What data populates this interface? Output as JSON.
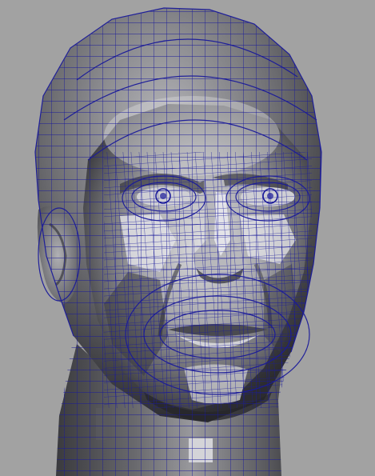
{
  "viewport": {
    "background_color": "#a2a2a2",
    "wireframe_color": "#1a1a9a",
    "mesh_shade_light": "#d8d8da",
    "mesh_shade_mid": "#8a8a8e",
    "mesh_shade_dark": "#3a3a3e",
    "subject": "head-mesh-icon"
  }
}
